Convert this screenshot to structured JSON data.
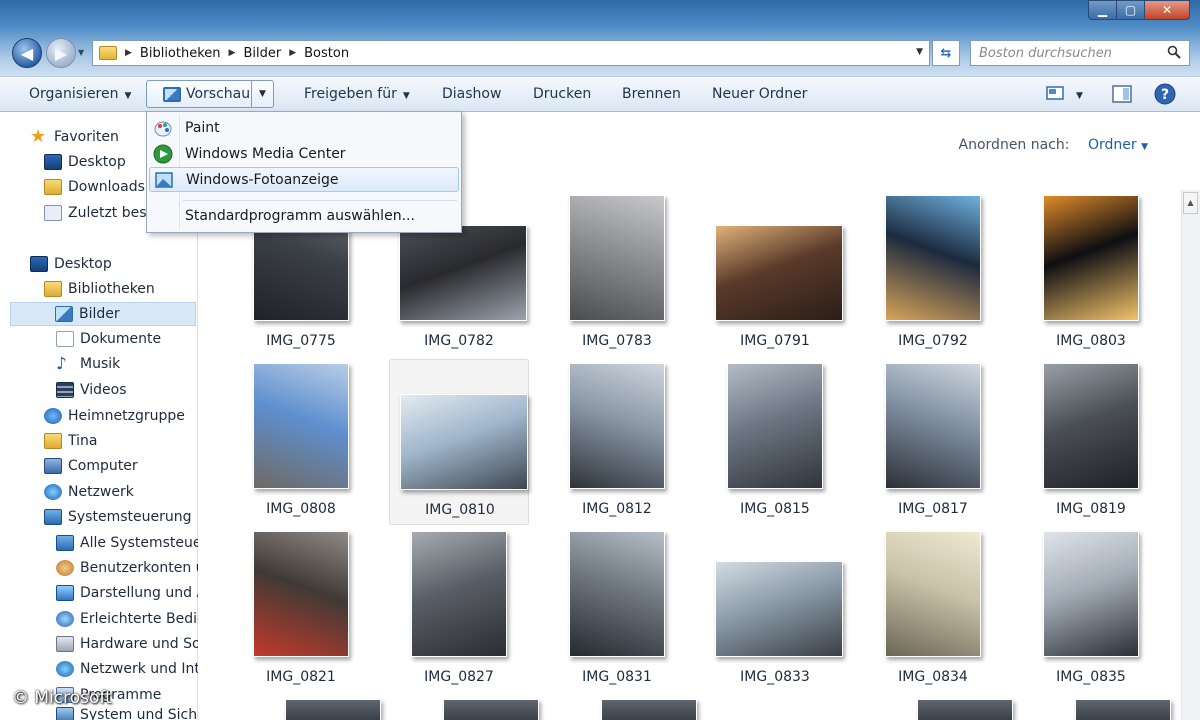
{
  "window": {
    "breadcrumbs": [
      "Bibliotheken",
      "Bilder",
      "Boston"
    ],
    "search_placeholder": "Boston durchsuchen"
  },
  "toolbar": {
    "organize": "Organisieren",
    "preview": "Vorschau",
    "share": "Freigeben für",
    "slideshow": "Diashow",
    "print": "Drucken",
    "burn": "Brennen",
    "new_folder": "Neuer Ordner"
  },
  "open_with_menu": {
    "items": [
      "Paint",
      "Windows Media Center",
      "Windows-Fotoanzeige"
    ],
    "highlighted": "Windows-Fotoanzeige",
    "choose_default": "Standardprogramm auswählen..."
  },
  "sidebar": {
    "favorites": "Favoriten",
    "favorite_items": [
      "Desktop",
      "Downloads",
      "Zuletzt besu"
    ],
    "desktop": "Desktop",
    "libraries": "Bibliotheken",
    "library_items": [
      "Bilder",
      "Dokumente",
      "Musik",
      "Videos"
    ],
    "selected": "Bilder",
    "other_items": [
      "Heimnetzgruppe",
      "Tina",
      "Computer",
      "Netzwerk",
      "Systemsteuerung"
    ],
    "control_panel_items": [
      "Alle Systemsteueru",
      "Benutzerkonten ur",
      "Darstellung und A",
      "Erleichterte Bedier",
      "Hardware und Sou",
      "Netzwerk und Inte",
      "Programme",
      "System und Sicher"
    ]
  },
  "content": {
    "sort_label": "Anordnen nach:",
    "sort_value": "Ordner",
    "selected_file": "IMG_0810",
    "files": [
      {
        "name": "IMG_0775",
        "orientation": "portrait"
      },
      {
        "name": "IMG_0782",
        "orientation": "landscape"
      },
      {
        "name": "IMG_0783",
        "orientation": "portrait"
      },
      {
        "name": "IMG_0791",
        "orientation": "landscape"
      },
      {
        "name": "IMG_0792",
        "orientation": "portrait"
      },
      {
        "name": "IMG_0803",
        "orientation": "portrait"
      },
      {
        "name": "IMG_0808",
        "orientation": "portrait"
      },
      {
        "name": "IMG_0810",
        "orientation": "landscape"
      },
      {
        "name": "IMG_0812",
        "orientation": "portrait"
      },
      {
        "name": "IMG_0815",
        "orientation": "portrait"
      },
      {
        "name": "IMG_0817",
        "orientation": "portrait"
      },
      {
        "name": "IMG_0819",
        "orientation": "portrait"
      },
      {
        "name": "IMG_0821",
        "orientation": "portrait"
      },
      {
        "name": "IMG_0827",
        "orientation": "portrait"
      },
      {
        "name": "IMG_0831",
        "orientation": "portrait"
      },
      {
        "name": "IMG_0833",
        "orientation": "landscape"
      },
      {
        "name": "IMG_0834",
        "orientation": "portrait"
      },
      {
        "name": "IMG_0835",
        "orientation": "portrait"
      }
    ]
  },
  "watermark": "© Microsoft",
  "colors": {
    "accent": "#1f5fa8",
    "selection": "#d9e8f8",
    "menu_highlight": "#dce9f9"
  }
}
